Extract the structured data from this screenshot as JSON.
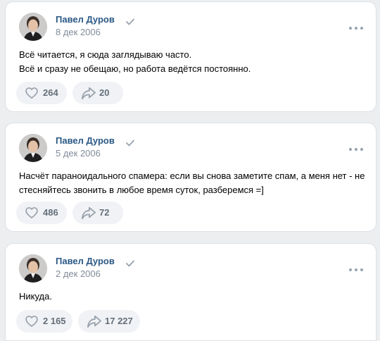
{
  "colors": {
    "page_bg": "#edeef0",
    "card_bg": "#ffffff",
    "author": "#2a5885",
    "meta": "#818c99",
    "pill_bg": "#f0f2f5",
    "icon": "#99a2ad"
  },
  "posts": [
    {
      "author": "Павел Дуров",
      "verified_icon": "verified-check-icon",
      "date": "8 дек 2006",
      "text_lines": [
        "Всё читается, я сюда заглядываю часто.",
        "Всё и сразу не обещаю, но работа ведётся постоянно."
      ],
      "likes": "264",
      "shares": "20"
    },
    {
      "author": "Павел Дуров",
      "verified_icon": "verified-check-icon",
      "date": "5 дек 2006",
      "text_lines": [
        "Насчёт параноидального спамера: если вы снова заметите спам, а меня нет - не",
        "стесняйтесь звонить в любое время суток, разберемся =]"
      ],
      "likes": "486",
      "shares": "72"
    },
    {
      "author": "Павел Дуров",
      "verified_icon": "verified-check-icon",
      "date": "2 дек 2006",
      "text_lines": [
        "Никуда."
      ],
      "likes": "2 165",
      "shares": "17 227"
    }
  ]
}
